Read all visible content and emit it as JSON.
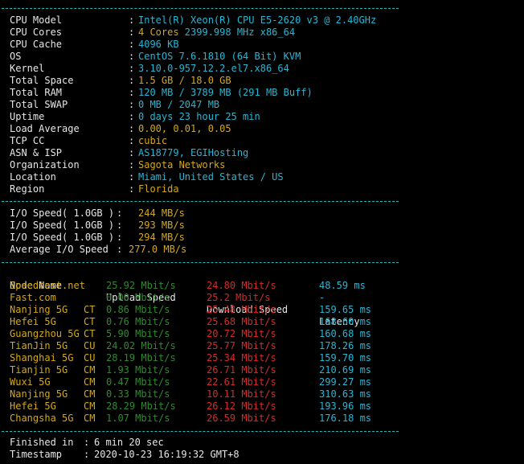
{
  "top_partial": "-----------------------------------------------",
  "system_info": [
    {
      "label": "CPU Model",
      "value": "Intel(R) Xeon(R) CPU E5-2620 v3 @ 2.40GHz",
      "color": "cyan"
    },
    {
      "label": "CPU Cores",
      "value": "4 Cores 2399.998 MHz x86_64",
      "color": "yellow-cyan"
    },
    {
      "label": "CPU Cache",
      "value": "4096 KB",
      "color": "cyan"
    },
    {
      "label": "OS",
      "value": "CentOS 7.6.1810 (64 Bit) KVM",
      "color": "cyan"
    },
    {
      "label": "Kernel",
      "value": "3.10.0-957.12.2.el7.x86_64",
      "color": "cyan"
    },
    {
      "label": "Total Space",
      "value": "1.5 GB / 18.0 GB",
      "color": "yellow"
    },
    {
      "label": "Total RAM",
      "value": "120 MB / 3789 MB (291 MB Buff)",
      "color": "cyan"
    },
    {
      "label": "Total SWAP",
      "value": "0 MB / 2047 MB",
      "color": "cyan"
    },
    {
      "label": "Uptime",
      "value": "0 days 23 hour 25 min",
      "color": "cyan"
    },
    {
      "label": "Load Average",
      "value": "0.00, 0.01, 0.05",
      "color": "yellow"
    },
    {
      "label": "TCP CC",
      "value": "cubic",
      "color": "yellow"
    },
    {
      "label": "ASN & ISP",
      "value": "AS18779, EGIHosting",
      "color": "cyan"
    },
    {
      "label": "Organization",
      "value": "Sagota Networks",
      "color": "yellow"
    },
    {
      "label": "Location",
      "value": "Miami, United States / US",
      "color": "cyan"
    },
    {
      "label": "Region",
      "value": "Florida",
      "color": "yellow"
    }
  ],
  "cores_prefix": "4 Cores",
  "cores_rest": "2399.998 MHz x86_64",
  "io": [
    {
      "label": "I/O Speed( 1.0GB )",
      "value": "244 MB/s"
    },
    {
      "label": "I/O Speed( 1.0GB )",
      "value": "293 MB/s"
    },
    {
      "label": "I/O Speed( 1.0GB )",
      "value": "294 MB/s"
    },
    {
      "label": "Average I/O Speed",
      "value": "277.0 MB/s"
    }
  ],
  "speed_headers": {
    "node": "Node Name",
    "upload": "Upload Speed",
    "download": "Download Speed",
    "latency": "Latency"
  },
  "speed_rows": [
    {
      "node": "Speedtest.net",
      "isp": "",
      "upload": "25.92 Mbit/s",
      "download": "24.80 Mbit/s",
      "latency": "48.59 ms"
    },
    {
      "node": "Fast.com",
      "isp": "",
      "upload": "0.00 Mbit/s",
      "download": "25.2 Mbit/s",
      "latency": "-"
    },
    {
      "node": "Nanjing 5G",
      "isp": "CT",
      "upload": "0.86 Mbit/s",
      "download": "25.48 Mbit/s",
      "latency": "159.65 ms"
    },
    {
      "node": "Hefei 5G",
      "isp": "CT",
      "upload": "0.76 Mbit/s",
      "download": "25.68 Mbit/s",
      "latency": "168.60 ms"
    },
    {
      "node": "Guangzhou 5G",
      "isp": "CT",
      "upload": "5.90 Mbit/s",
      "download": "20.72 Mbit/s",
      "latency": "160.68 ms"
    },
    {
      "node": "TianJin 5G",
      "isp": "CU",
      "upload": "24.02 Mbit/s",
      "download": "25.77 Mbit/s",
      "latency": "178.26 ms"
    },
    {
      "node": "Shanghai 5G",
      "isp": "CU",
      "upload": "28.19 Mbit/s",
      "download": "25.34 Mbit/s",
      "latency": "159.70 ms"
    },
    {
      "node": "Tianjin 5G",
      "isp": "CM",
      "upload": "1.93 Mbit/s",
      "download": "26.71 Mbit/s",
      "latency": "210.69 ms"
    },
    {
      "node": "Wuxi 5G",
      "isp": "CM",
      "upload": "0.47 Mbit/s",
      "download": "22.61 Mbit/s",
      "latency": "299.27 ms"
    },
    {
      "node": "Nanjing 5G",
      "isp": "CM",
      "upload": "0.33 Mbit/s",
      "download": "10.11 Mbit/s",
      "latency": "310.63 ms"
    },
    {
      "node": "Hefei 5G",
      "isp": "CM",
      "upload": "28.29 Mbit/s",
      "download": "26.12 Mbit/s",
      "latency": "193.96 ms"
    },
    {
      "node": "Changsha 5G",
      "isp": "CM",
      "upload": "1.07 Mbit/s",
      "download": "26.59 Mbit/s",
      "latency": "176.18 ms"
    }
  ],
  "footer": [
    {
      "label": "Finished in",
      "value": "6 min 20 sec"
    },
    {
      "label": "Timestamp",
      "value": "2020-10-23 16:19:32 GMT+8"
    }
  ],
  "colors": {
    "cyan": "#27b6d4",
    "yellow": "#d4a917",
    "green": "#3aa832",
    "red": "#d52a2a",
    "separator": "#1fb8b8"
  }
}
